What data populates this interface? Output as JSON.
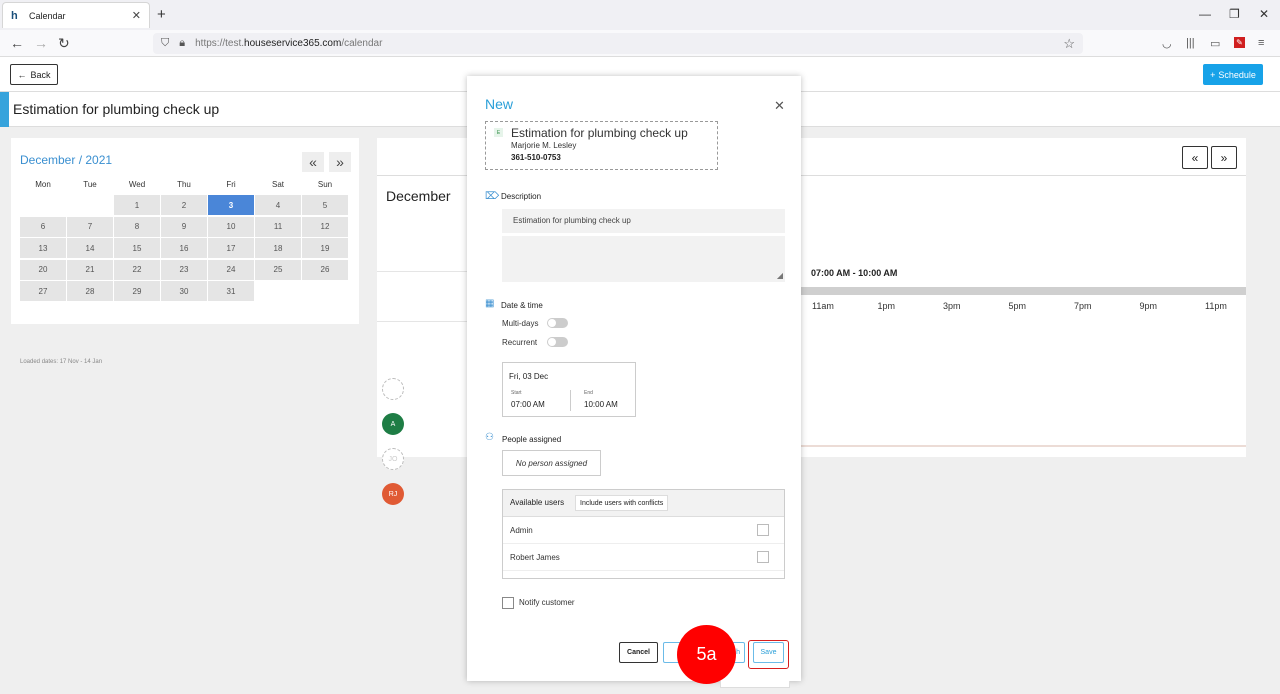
{
  "browser": {
    "tab_title": "Calendar",
    "favicon": "h",
    "url_domain": "houseservice365.com",
    "url_prefix": "https://test.",
    "url_path": "/calendar"
  },
  "header": {
    "back_label": "Back",
    "schedule_label": "Schedule",
    "page_title": "Estimation for plumbing check up"
  },
  "mini_calendar": {
    "month_label": "December / 2021",
    "prev": "«",
    "next": "»",
    "weekdays": [
      "Mon",
      "Tue",
      "Wed",
      "Thu",
      "Fri",
      "Sat",
      "Sun"
    ],
    "weeks": [
      [
        "",
        "",
        "1",
        "2",
        "3",
        "4",
        "5"
      ],
      [
        "6",
        "7",
        "8",
        "9",
        "10",
        "11",
        "12"
      ],
      [
        "13",
        "14",
        "15",
        "16",
        "17",
        "18",
        "19"
      ],
      [
        "20",
        "21",
        "22",
        "23",
        "24",
        "25",
        "26"
      ],
      [
        "27",
        "28",
        "29",
        "30",
        "31",
        "",
        ""
      ]
    ],
    "selected_day": "3",
    "loaded_dates": "Loaded dates: 17 Nov - 14 Jan"
  },
  "calendar": {
    "month": "December",
    "time_band": "07:00 AM - 10:00 AM",
    "hours": [
      "11am",
      "1pm",
      "3pm",
      "5pm",
      "7pm",
      "9pm",
      "11pm"
    ],
    "avatars": [
      {
        "initials": "",
        "color": "#ffffff"
      },
      {
        "initials": "A",
        "color": "#1e7d45"
      },
      {
        "initials": "JO",
        "color": "#ffffff"
      },
      {
        "initials": "RJ",
        "color": "#e05a34"
      }
    ]
  },
  "modal": {
    "title": "New",
    "job": {
      "badge": "E",
      "title": "Estimation for plumbing check up",
      "customer": "Marjorie M. Lesley",
      "phone": "361-510-0753"
    },
    "description_label": "Description",
    "description_value": "Estimation for plumbing check up",
    "datetime_label": "Date & time",
    "multi_days_label": "Multi-days",
    "recurrent_label": "Recurrent",
    "date_value": "Fri, 03 Dec",
    "start_label": "Start",
    "start_value": "07:00 AM",
    "end_label": "End",
    "end_value": "10:00 AM",
    "people_label": "People assigned",
    "no_person": "No person assigned",
    "available_users_label": "Available users",
    "include_conflicts_label": "Include users with conflicts",
    "users": [
      "Admin",
      "Robert James"
    ],
    "notify_label": "Notify customer",
    "cancel_label": "Cancel",
    "finish_label": "h",
    "save_label": "Save"
  },
  "annotation": {
    "step_label": "5a"
  },
  "colors": {
    "accent": "#2a9fd8",
    "schedule_button": "#17a2e8",
    "selected_day": "#4a86d8",
    "annotation": "#ff0000"
  }
}
